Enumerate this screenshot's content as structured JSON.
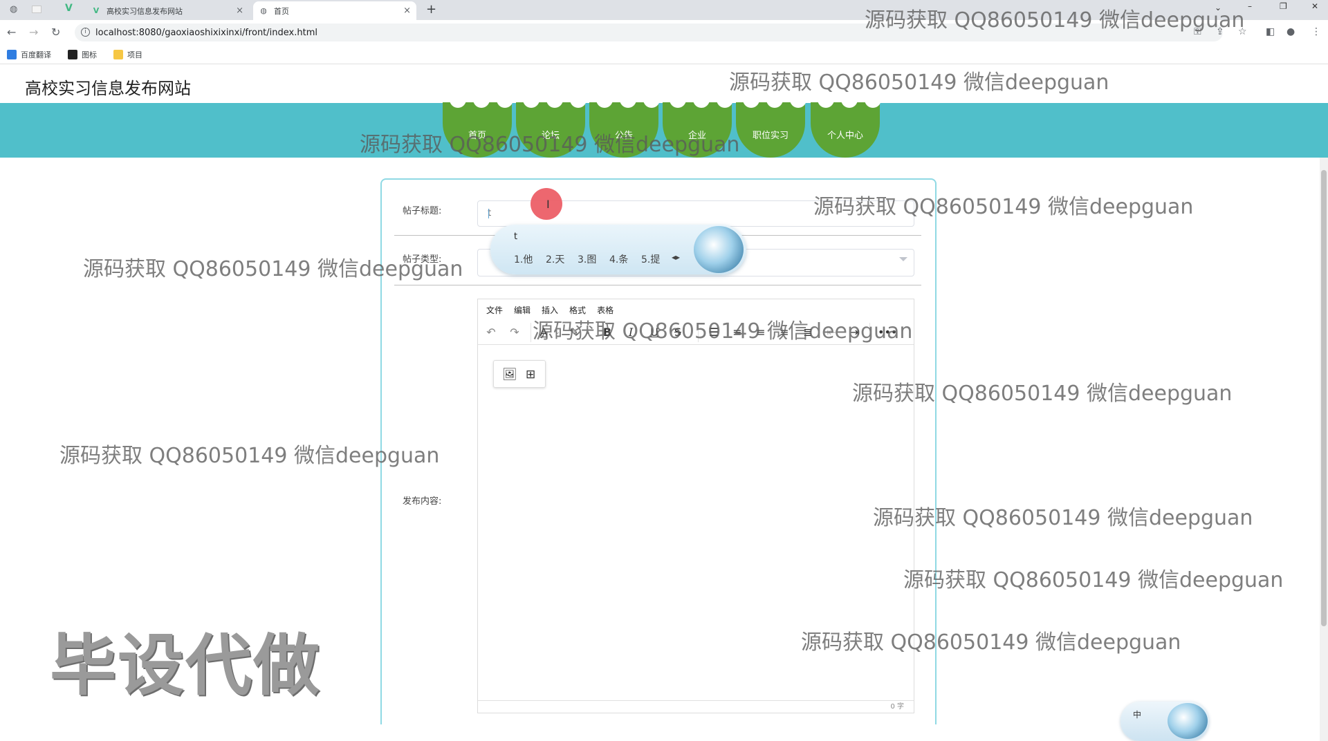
{
  "browser": {
    "tabs": [
      {
        "title": "高校实习信息发布网站",
        "close": "×"
      },
      {
        "title": "首页",
        "close": "×"
      }
    ],
    "new_tab": "+",
    "url": "localhost:8080/gaoxiaoshixixinxi/front/index.html",
    "bookmarks": [
      {
        "label": "百度翻译"
      },
      {
        "label": "图标"
      },
      {
        "label": "项目"
      }
    ]
  },
  "site": {
    "title": "高校实习信息发布网站",
    "nav": [
      "首页",
      "论坛",
      "公告",
      "企业",
      "职位实习",
      "个人中心"
    ]
  },
  "form": {
    "title_label": "帖子标题:",
    "title_value": "t",
    "type_label": "帖子类型:",
    "content_label": "发布内容:"
  },
  "editor": {
    "menu": [
      "文件",
      "编辑",
      "插入",
      "格式",
      "表格"
    ],
    "word_count": "0 字"
  },
  "ime": {
    "composition": "t",
    "candidates": [
      "1.他",
      "2.天",
      "3.图",
      "4.条",
      "5.提"
    ],
    "status_label": "中"
  },
  "watermarks": {
    "text": "源码获取 QQ86050149 微信deepguan",
    "big": "毕设代做"
  },
  "colors": {
    "nav_band": "#50bfca",
    "nav_item": "#5da435",
    "card_border": "#8fd9e4",
    "click_marker": "#ec5a63"
  }
}
